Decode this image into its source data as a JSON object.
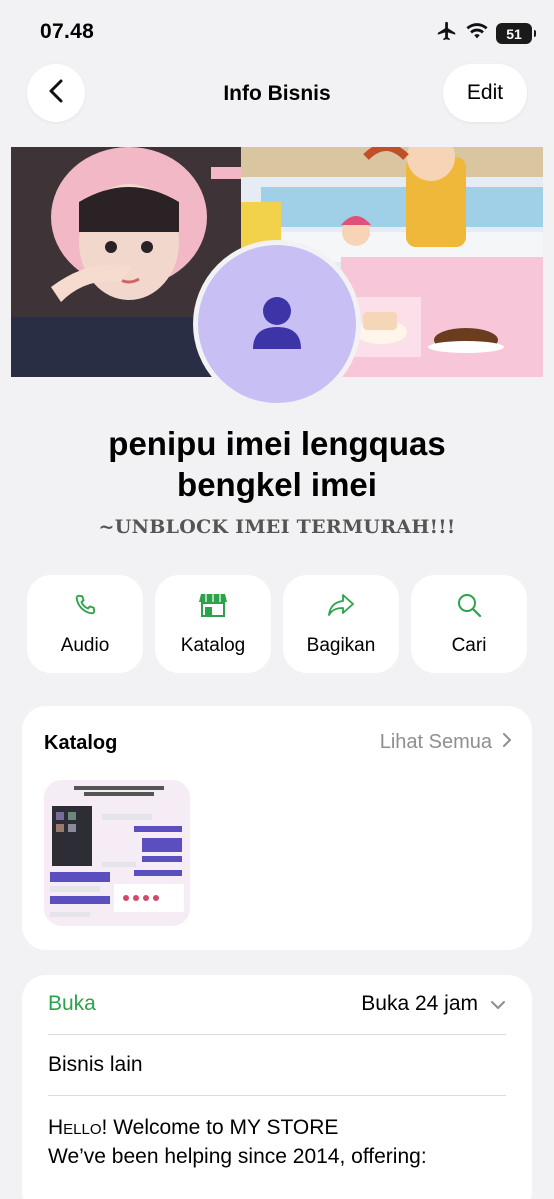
{
  "status_bar": {
    "time": "07.48",
    "battery": "51"
  },
  "nav": {
    "title": "Info Bisnis",
    "edit_label": "Edit"
  },
  "profile": {
    "name_line1": "penipu imei lengquas",
    "name_line2": "bengkel imei",
    "tagline": "~UNBLOCK IMEI TERMURAH!!!"
  },
  "actions": [
    {
      "label": "Audio",
      "icon": "phone-icon"
    },
    {
      "label": "Katalog",
      "icon": "store-icon"
    },
    {
      "label": "Bagikan",
      "icon": "share-icon"
    },
    {
      "label": "Cari",
      "icon": "search-icon"
    }
  ],
  "catalog": {
    "title": "Katalog",
    "see_all": "Lihat Semua"
  },
  "info": {
    "open_label": "Buka",
    "hours": "Buka 24 jam",
    "other_business": "Bisnis lain",
    "desc_hello": "Hello",
    "desc_line1_rest": "! Welcome to MY STORE",
    "desc_line2": "We’ve been helping since 2014, offering:"
  },
  "colors": {
    "accent_green": "#2aa34a",
    "avatar_bg": "#c8c0f5",
    "avatar_icon": "#3d34a8",
    "background": "#f2f2f4"
  }
}
